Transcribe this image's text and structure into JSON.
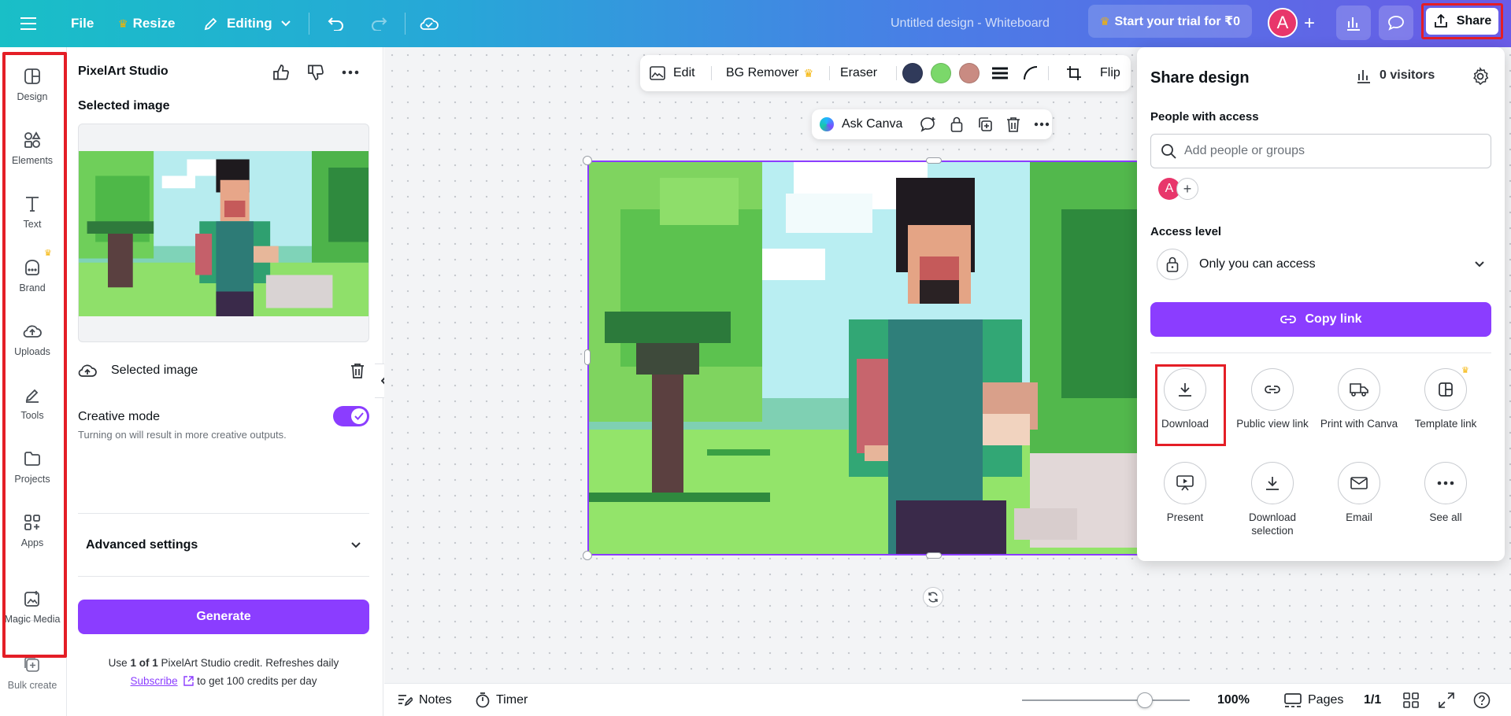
{
  "topbar": {
    "file": "File",
    "resize": "Resize",
    "editing": "Editing",
    "doc_title": "Untitled design - Whiteboard",
    "trial": "Start your trial for ₹0",
    "avatar": "A",
    "share": "Share"
  },
  "rail": [
    {
      "label": "Design",
      "icon": "design-icon"
    },
    {
      "label": "Elements",
      "icon": "elements-icon"
    },
    {
      "label": "Text",
      "icon": "text-icon"
    },
    {
      "label": "Brand",
      "icon": "brand-icon"
    },
    {
      "label": "Uploads",
      "icon": "uploads-icon"
    },
    {
      "label": "Tools",
      "icon": "tools-icon"
    },
    {
      "label": "Projects",
      "icon": "projects-icon"
    },
    {
      "label": "Apps",
      "icon": "apps-icon"
    },
    {
      "label": "Magic Media",
      "icon": "magic-media-icon"
    },
    {
      "label": "Bulk create",
      "icon": "bulk-create-icon"
    }
  ],
  "panel": {
    "title": "PixelArt Studio",
    "selected_heading": "Selected image",
    "selected_label": "Selected image",
    "creative_label": "Creative mode",
    "creative_sub": "Turning on will result in more creative outputs.",
    "creative_on": true,
    "advanced": "Advanced settings",
    "generate": "Generate",
    "credit_prefix": "Use ",
    "credit_bold": "1 of 1",
    "credit_suffix": " PixelArt Studio credit. Refreshes daily",
    "subscribe": "Subscribe",
    "subscribe_suffix": " to get 100 credits per day"
  },
  "context_toolbar": {
    "edit": "Edit",
    "bg_remover": "BG Remover",
    "eraser": "Eraser",
    "swatches": [
      "#303a5a",
      "#7bd86a",
      "#c98b82"
    ],
    "flip": "Flip"
  },
  "ask_bar": {
    "label": "Ask Canva"
  },
  "share_panel": {
    "title": "Share design",
    "visitors": "0 visitors",
    "people_heading": "People with access",
    "search_placeholder": "Add people or groups",
    "avatar": "A",
    "access_heading": "Access level",
    "access_value": "Only you can access",
    "copy_link": "Copy link",
    "options": [
      {
        "label": "Download",
        "icon": "download-icon"
      },
      {
        "label": "Public view link",
        "icon": "link-icon"
      },
      {
        "label": "Print with Canva",
        "icon": "truck-icon"
      },
      {
        "label": "Template link",
        "icon": "template-icon"
      },
      {
        "label": "Present",
        "icon": "present-icon"
      },
      {
        "label": "Download selection",
        "icon": "download-icon"
      },
      {
        "label": "Email",
        "icon": "email-icon"
      },
      {
        "label": "See all",
        "icon": "more-icon"
      }
    ]
  },
  "bottombar": {
    "notes": "Notes",
    "timer": "Timer",
    "zoom": "100%",
    "zoom_fraction": 0.68,
    "pages": "Pages",
    "page_count": "1/1"
  },
  "colors": {
    "accent": "#8b3dff",
    "highlight": "#e41e26",
    "avatar": "#e8366b",
    "crown": "#f5b300"
  }
}
